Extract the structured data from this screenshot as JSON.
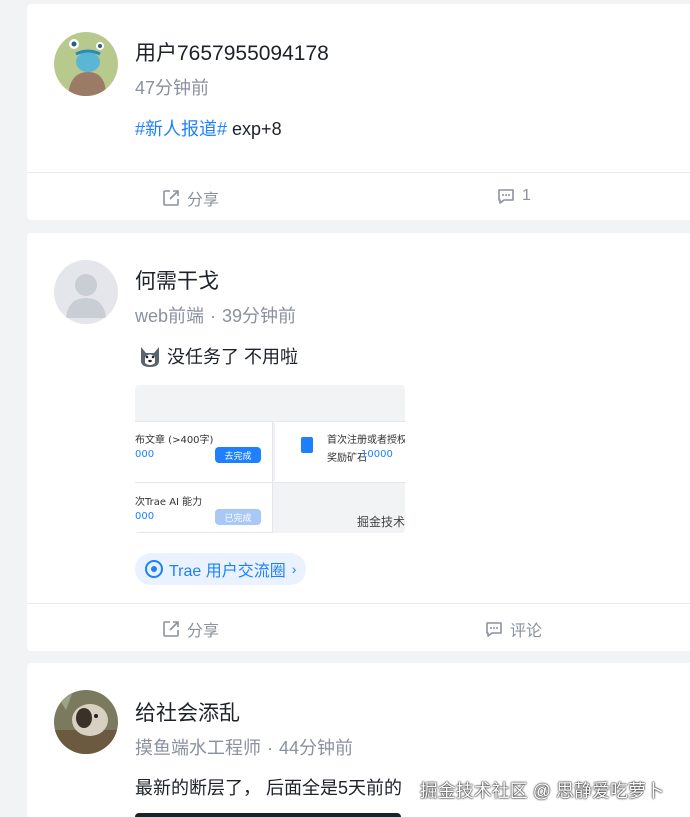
{
  "posts": [
    {
      "author": "用户7657955094178",
      "time": "47分钟前",
      "topic": "#新人报道#",
      "text": " exp+8",
      "share_label": "分享",
      "comment_label": "1"
    },
    {
      "author": "何需干戈",
      "job": "web前端",
      "separator": "·",
      "time": "39分钟前",
      "text": "没任务了 不用啦",
      "emoji": "husky-face",
      "image": {
        "task1_title": "布文章 (>400字)",
        "task1_value": "000",
        "task1_button": "去完成",
        "task2_title": "首次注册或者授权登",
        "task2_value_label": "奖励矿石",
        "task2_value": "10000",
        "task3_title": "次Trae AI 能力",
        "task3_value": "000",
        "task3_button": "已完成",
        "watermark": "掘金技术"
      },
      "circle": "Trae 用户交流圈",
      "share_label": "分享",
      "comment_label": "评论"
    },
    {
      "author": "给社会添乱",
      "job": "摸鱼端水工程师",
      "separator": "·",
      "time": "44分钟前",
      "text": "最新的断层了， 后面全是5天前的"
    }
  ],
  "watermark": "掘金技术社区 @ 思静爱吃萝卜",
  "colors": {
    "accent": "#1e80ff",
    "muted": "#8a919f",
    "text": "#1d2129"
  }
}
